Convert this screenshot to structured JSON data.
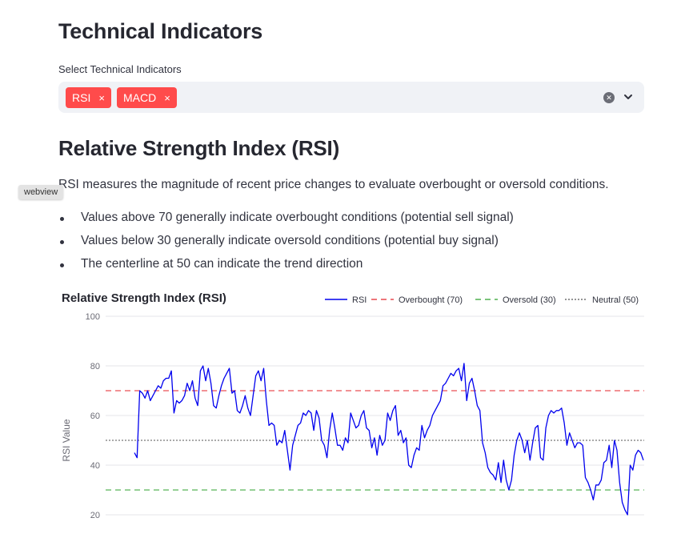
{
  "page": {
    "title": "Technical Indicators"
  },
  "select": {
    "label": "Select Technical Indicators",
    "chips": [
      "RSI",
      "MACD"
    ],
    "remove_glyph": "×",
    "clear_glyph": "✕"
  },
  "section": {
    "title": "Relative Strength Index (RSI)",
    "description": "RSI measures the magnitude of recent price changes to evaluate overbought or oversold conditions.",
    "bullets": [
      "Values above 70 generally indicate overbought conditions (potential sell signal)",
      "Values below 30 generally indicate oversold conditions (potential buy signal)",
      "The centerline at 50 can indicate the trend direction"
    ]
  },
  "tooltip": {
    "text": "webview"
  },
  "colors": {
    "chip": "#ff4b4b",
    "rsi": "#0000ee",
    "overbought": "#e4252b",
    "oversold": "#2ca02c",
    "neutral": "#555555"
  },
  "chart_data": {
    "type": "line",
    "title": "Relative Strength Index (RSI)",
    "ylabel": "RSI Value",
    "ylim": [
      20,
      100
    ],
    "yticks": [
      20,
      40,
      60,
      80,
      100
    ],
    "grid": true,
    "legend_position": "top-right",
    "legend": [
      "RSI",
      "Overbought (70)",
      "Oversold (30)",
      "Neutral (50)"
    ],
    "reference_lines": [
      {
        "name": "Overbought (70)",
        "y": 70,
        "style": "dashed",
        "color": "#e4252b"
      },
      {
        "name": "Oversold (30)",
        "y": 30,
        "style": "dashed",
        "color": "#2ca02c"
      },
      {
        "name": "Neutral (50)",
        "y": 50,
        "style": "dotted",
        "color": "#555555"
      }
    ],
    "series": [
      {
        "name": "RSI",
        "color": "#0000ee",
        "values": [
          45,
          43,
          70,
          69,
          67,
          70,
          66,
          68,
          70,
          72,
          71,
          74,
          75,
          75,
          78,
          61,
          66,
          65,
          66,
          68,
          73,
          70,
          74,
          67,
          64,
          78,
          80,
          74,
          79,
          73,
          64,
          63,
          68,
          72,
          75,
          77,
          79,
          69,
          70,
          62,
          61,
          64,
          68,
          63,
          60,
          68,
          76,
          78,
          74,
          79,
          66,
          56,
          57,
          56,
          48,
          50,
          49,
          54,
          46,
          38,
          48,
          52,
          56,
          57,
          61,
          60,
          62,
          61,
          54,
          62,
          59,
          50,
          48,
          43,
          54,
          61,
          55,
          48,
          48,
          46,
          51,
          49,
          61,
          58,
          55,
          56,
          60,
          62,
          55,
          54,
          47,
          51,
          44,
          52,
          48,
          50,
          61,
          58,
          62,
          64,
          52,
          54,
          49,
          51,
          40,
          39,
          44,
          47,
          46,
          56,
          51,
          54,
          56,
          60,
          62,
          64,
          66,
          72,
          73,
          75,
          77,
          76,
          78,
          79,
          74,
          81,
          66,
          73,
          75,
          70,
          64,
          62,
          49,
          45,
          39,
          37,
          36,
          34,
          41,
          33,
          42,
          34,
          30,
          34,
          44,
          50,
          53,
          50,
          45,
          50,
          42,
          49,
          55,
          56,
          43,
          42,
          55,
          60,
          62,
          61,
          62,
          62,
          63,
          57,
          48,
          53,
          50,
          47,
          49,
          49,
          48,
          35,
          33,
          30,
          26,
          32,
          32,
          34,
          41,
          42,
          48,
          39,
          50,
          46,
          33,
          25,
          22,
          20,
          40,
          38,
          44,
          46,
          45,
          42
        ]
      }
    ]
  }
}
